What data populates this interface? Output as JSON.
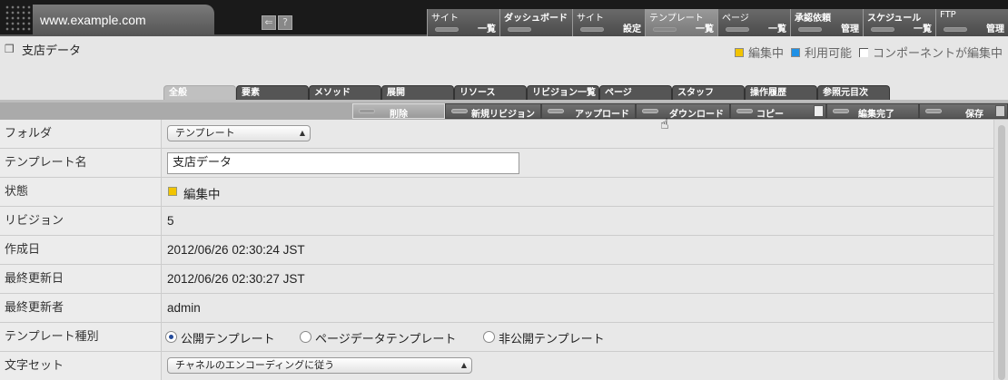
{
  "header": {
    "site_url": "www.example.com",
    "back_icon": "back-arrow-icon",
    "help_label": "?"
  },
  "topnav": [
    {
      "label": "サイト",
      "sub": "一覧"
    },
    {
      "label": "ダッシュボード",
      "sub": ""
    },
    {
      "label": "サイト",
      "sub": "設定"
    },
    {
      "label": "テンプレート",
      "sub": "一覧"
    },
    {
      "label": "ページ",
      "sub": "一覧"
    },
    {
      "label": "承認依頼",
      "sub": "管理"
    },
    {
      "label": "スケジュール",
      "sub": "一覧"
    },
    {
      "label": "FTP",
      "sub": "管理"
    }
  ],
  "page": {
    "title": "支店データ",
    "legend": [
      {
        "label": "編集中",
        "color": "#f2c400"
      },
      {
        "label": "利用可能",
        "color": "#1e90e6"
      },
      {
        "label": "コンポーネントが編集中",
        "color": "#ffffff"
      }
    ]
  },
  "tabs": [
    "全般",
    "要素",
    "メソッド",
    "展開",
    "リソース",
    "リビジョン一覧",
    "ページ",
    "スタッフ",
    "操作履歴",
    "参照元目次"
  ],
  "actions": [
    "削除",
    "新規リビジョン",
    "アップロード",
    "ダウンロード",
    "コピー",
    "編集完了",
    "保存"
  ],
  "form": {
    "folder": {
      "label": "フォルダ",
      "value": "テンプレート"
    },
    "name": {
      "label": "テンプレート名",
      "value": "支店データ"
    },
    "status": {
      "label": "状態",
      "value": "編集中"
    },
    "revision": {
      "label": "リビジョン",
      "value": "5"
    },
    "created": {
      "label": "作成日",
      "value": "2012/06/26 02:30:24 JST"
    },
    "updated": {
      "label": "最終更新日",
      "value": "2012/06/26 02:30:27 JST"
    },
    "updater": {
      "label": "最終更新者",
      "value": "admin"
    },
    "type": {
      "label": "テンプレート種別",
      "options": [
        "公開テンプレート",
        "ページデータテンプレート",
        "非公開テンプレート"
      ]
    },
    "charset": {
      "label": "文字セット",
      "value": "チャネルのエンコーディングに従う"
    }
  }
}
